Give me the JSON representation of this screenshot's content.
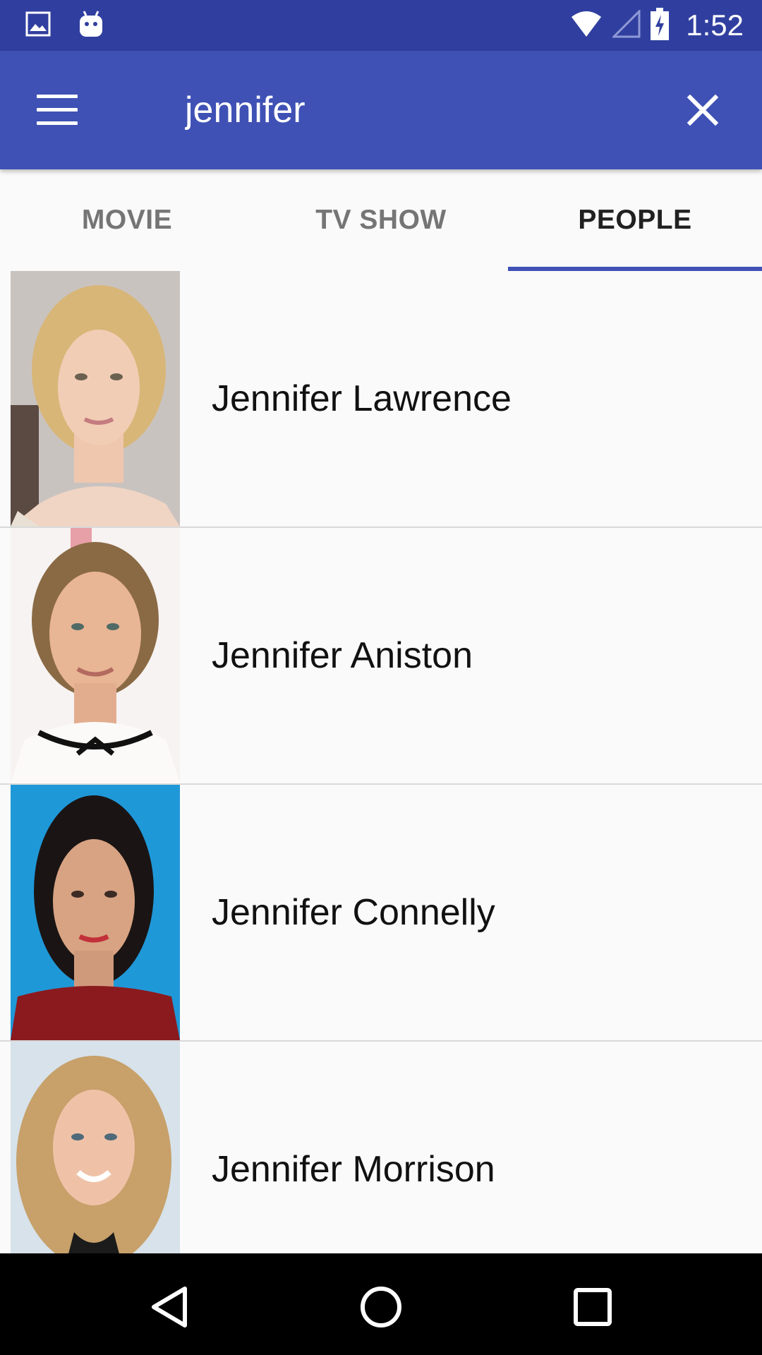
{
  "status_bar": {
    "time": "1:52",
    "icons": [
      "image-icon",
      "android-icon",
      "wifi-icon",
      "signal-icon",
      "battery-charging-icon"
    ]
  },
  "toolbar": {
    "menu_icon": "hamburger-menu-icon",
    "search_value": "jennifer",
    "clear_icon": "close-icon"
  },
  "tabs": [
    {
      "label": "MOVIE",
      "active": false
    },
    {
      "label": "TV SHOW",
      "active": false
    },
    {
      "label": "PEOPLE",
      "active": true
    }
  ],
  "people": [
    {
      "name": "Jennifer Lawrence"
    },
    {
      "name": "Jennifer Aniston"
    },
    {
      "name": "Jennifer Connelly"
    },
    {
      "name": "Jennifer Morrison"
    }
  ],
  "nav_bar": {
    "icons": [
      "back-icon",
      "home-icon",
      "recents-icon"
    ]
  },
  "colors": {
    "status_bar": "#303f9f",
    "toolbar": "#3f51b5",
    "accent": "#3f51b5"
  }
}
